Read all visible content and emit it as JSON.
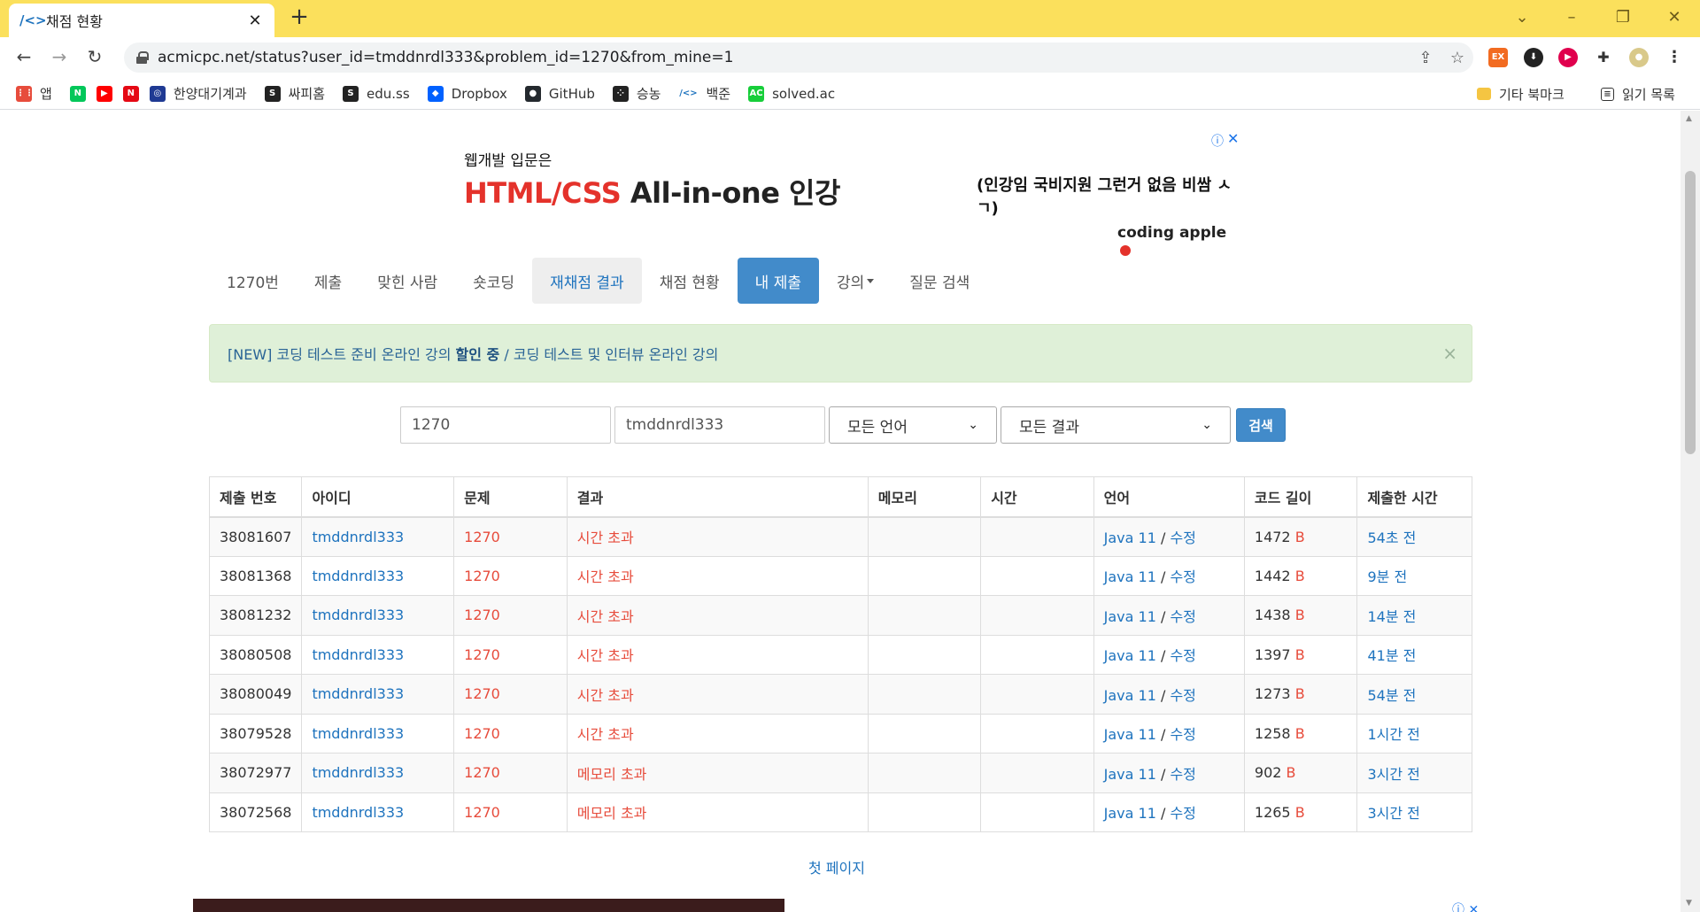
{
  "browser": {
    "tab_title": "채점 현황",
    "tab_favicon": "/<>",
    "url": "acmicpc.net/status?user_id=tmddnrdl333&problem_id=1270&from_mine=1",
    "extensions": [
      "EX"
    ],
    "bookmarks": [
      {
        "label": "앱",
        "icon": "apps-grid-icon",
        "color": "#e74c3c"
      },
      {
        "label": "",
        "icon": "naver-icon",
        "color": "#03c75a"
      },
      {
        "label": "",
        "icon": "youtube-icon",
        "color": "#ff0000"
      },
      {
        "label": "",
        "icon": "netflix-icon",
        "color": "#e50914"
      },
      {
        "label": "한양대기계과",
        "icon": "hanyang-icon",
        "color": "#1f3a93"
      },
      {
        "label": "싸피홈",
        "icon": "ssafy-icon",
        "color": "#222222"
      },
      {
        "label": "edu.ss",
        "icon": "edu-icon",
        "color": "#222222"
      },
      {
        "label": "Dropbox",
        "icon": "dropbox-icon",
        "color": "#0061ff"
      },
      {
        "label": "GitHub",
        "icon": "github-icon",
        "color": "#24292e"
      },
      {
        "label": "승농",
        "icon": "dots-icon",
        "color": "#222222"
      },
      {
        "label": "백준",
        "icon": "baekjoon-icon",
        "color": "#1e73be"
      },
      {
        "label": "solved.ac",
        "icon": "solvedac-icon",
        "color": "#17ce3a"
      }
    ],
    "bookmarks_right": [
      "기타 북마크",
      "읽기 목록"
    ]
  },
  "ad": {
    "subtitle": "웹개발 입문은",
    "headline_red": "HTML/CSS",
    "headline_dark": "All-in-one 인강",
    "right_text": "(인강임 국비지원 그런거 없음 비쌈 ㅅㄱ)",
    "brand": "coding apple"
  },
  "nav": {
    "items": [
      {
        "label": "1270번",
        "state": "normal"
      },
      {
        "label": "제출",
        "state": "normal"
      },
      {
        "label": "맞힌 사람",
        "state": "normal"
      },
      {
        "label": "숏코딩",
        "state": "normal"
      },
      {
        "label": "재채점 결과",
        "state": "grey"
      },
      {
        "label": "채점 현황",
        "state": "normal"
      },
      {
        "label": "내 제출",
        "state": "active"
      },
      {
        "label": "강의",
        "state": "dropdown"
      },
      {
        "label": "질문 검색",
        "state": "normal"
      }
    ]
  },
  "alert": {
    "part1": "[NEW] 코딩 테스트 준비 온라인 강의 ",
    "bold": "할인 중",
    "part2": " / 코딩 테스트 및 인터뷰 온라인 강의",
    "close": "×"
  },
  "search": {
    "problem_id": "1270",
    "user_id": "tmddnrdl333",
    "language": "모든 언어",
    "result": "모든 결과",
    "button": "검색"
  },
  "table": {
    "headers": [
      "제출 번호",
      "아이디",
      "문제",
      "결과",
      "메모리",
      "시간",
      "언어",
      "코드 길이",
      "제출한 시간"
    ],
    "rows": [
      {
        "id": "38081607",
        "user": "tmddnrdl333",
        "problem": "1270",
        "result": "시간 초과",
        "memory": "",
        "time": "",
        "lang": "Java 11",
        "edit": "수정",
        "length": "1472",
        "unit": "B",
        "submitted": "54초 전"
      },
      {
        "id": "38081368",
        "user": "tmddnrdl333",
        "problem": "1270",
        "result": "시간 초과",
        "memory": "",
        "time": "",
        "lang": "Java 11",
        "edit": "수정",
        "length": "1442",
        "unit": "B",
        "submitted": "9분 전"
      },
      {
        "id": "38081232",
        "user": "tmddnrdl333",
        "problem": "1270",
        "result": "시간 초과",
        "memory": "",
        "time": "",
        "lang": "Java 11",
        "edit": "수정",
        "length": "1438",
        "unit": "B",
        "submitted": "14분 전"
      },
      {
        "id": "38080508",
        "user": "tmddnrdl333",
        "problem": "1270",
        "result": "시간 초과",
        "memory": "",
        "time": "",
        "lang": "Java 11",
        "edit": "수정",
        "length": "1397",
        "unit": "B",
        "submitted": "41분 전"
      },
      {
        "id": "38080049",
        "user": "tmddnrdl333",
        "problem": "1270",
        "result": "시간 초과",
        "memory": "",
        "time": "",
        "lang": "Java 11",
        "edit": "수정",
        "length": "1273",
        "unit": "B",
        "submitted": "54분 전"
      },
      {
        "id": "38079528",
        "user": "tmddnrdl333",
        "problem": "1270",
        "result": "시간 초과",
        "memory": "",
        "time": "",
        "lang": "Java 11",
        "edit": "수정",
        "length": "1258",
        "unit": "B",
        "submitted": "1시간 전"
      },
      {
        "id": "38072977",
        "user": "tmddnrdl333",
        "problem": "1270",
        "result": "메모리 초과",
        "memory": "",
        "time": "",
        "lang": "Java 11",
        "edit": "수정",
        "length": "902",
        "unit": "B",
        "submitted": "3시간 전"
      },
      {
        "id": "38072568",
        "user": "tmddnrdl333",
        "problem": "1270",
        "result": "메모리 초과",
        "memory": "",
        "time": "",
        "lang": "Java 11",
        "edit": "수정",
        "length": "1265",
        "unit": "B",
        "submitted": "3시간 전"
      }
    ]
  },
  "pager": {
    "first_page": "첫 페이지"
  },
  "colors": {
    "tabstrip": "#fbe05c",
    "link": "#1e73be",
    "error": "#e74c3c",
    "primary": "#428bca",
    "alert_bg": "#dff0d8"
  }
}
